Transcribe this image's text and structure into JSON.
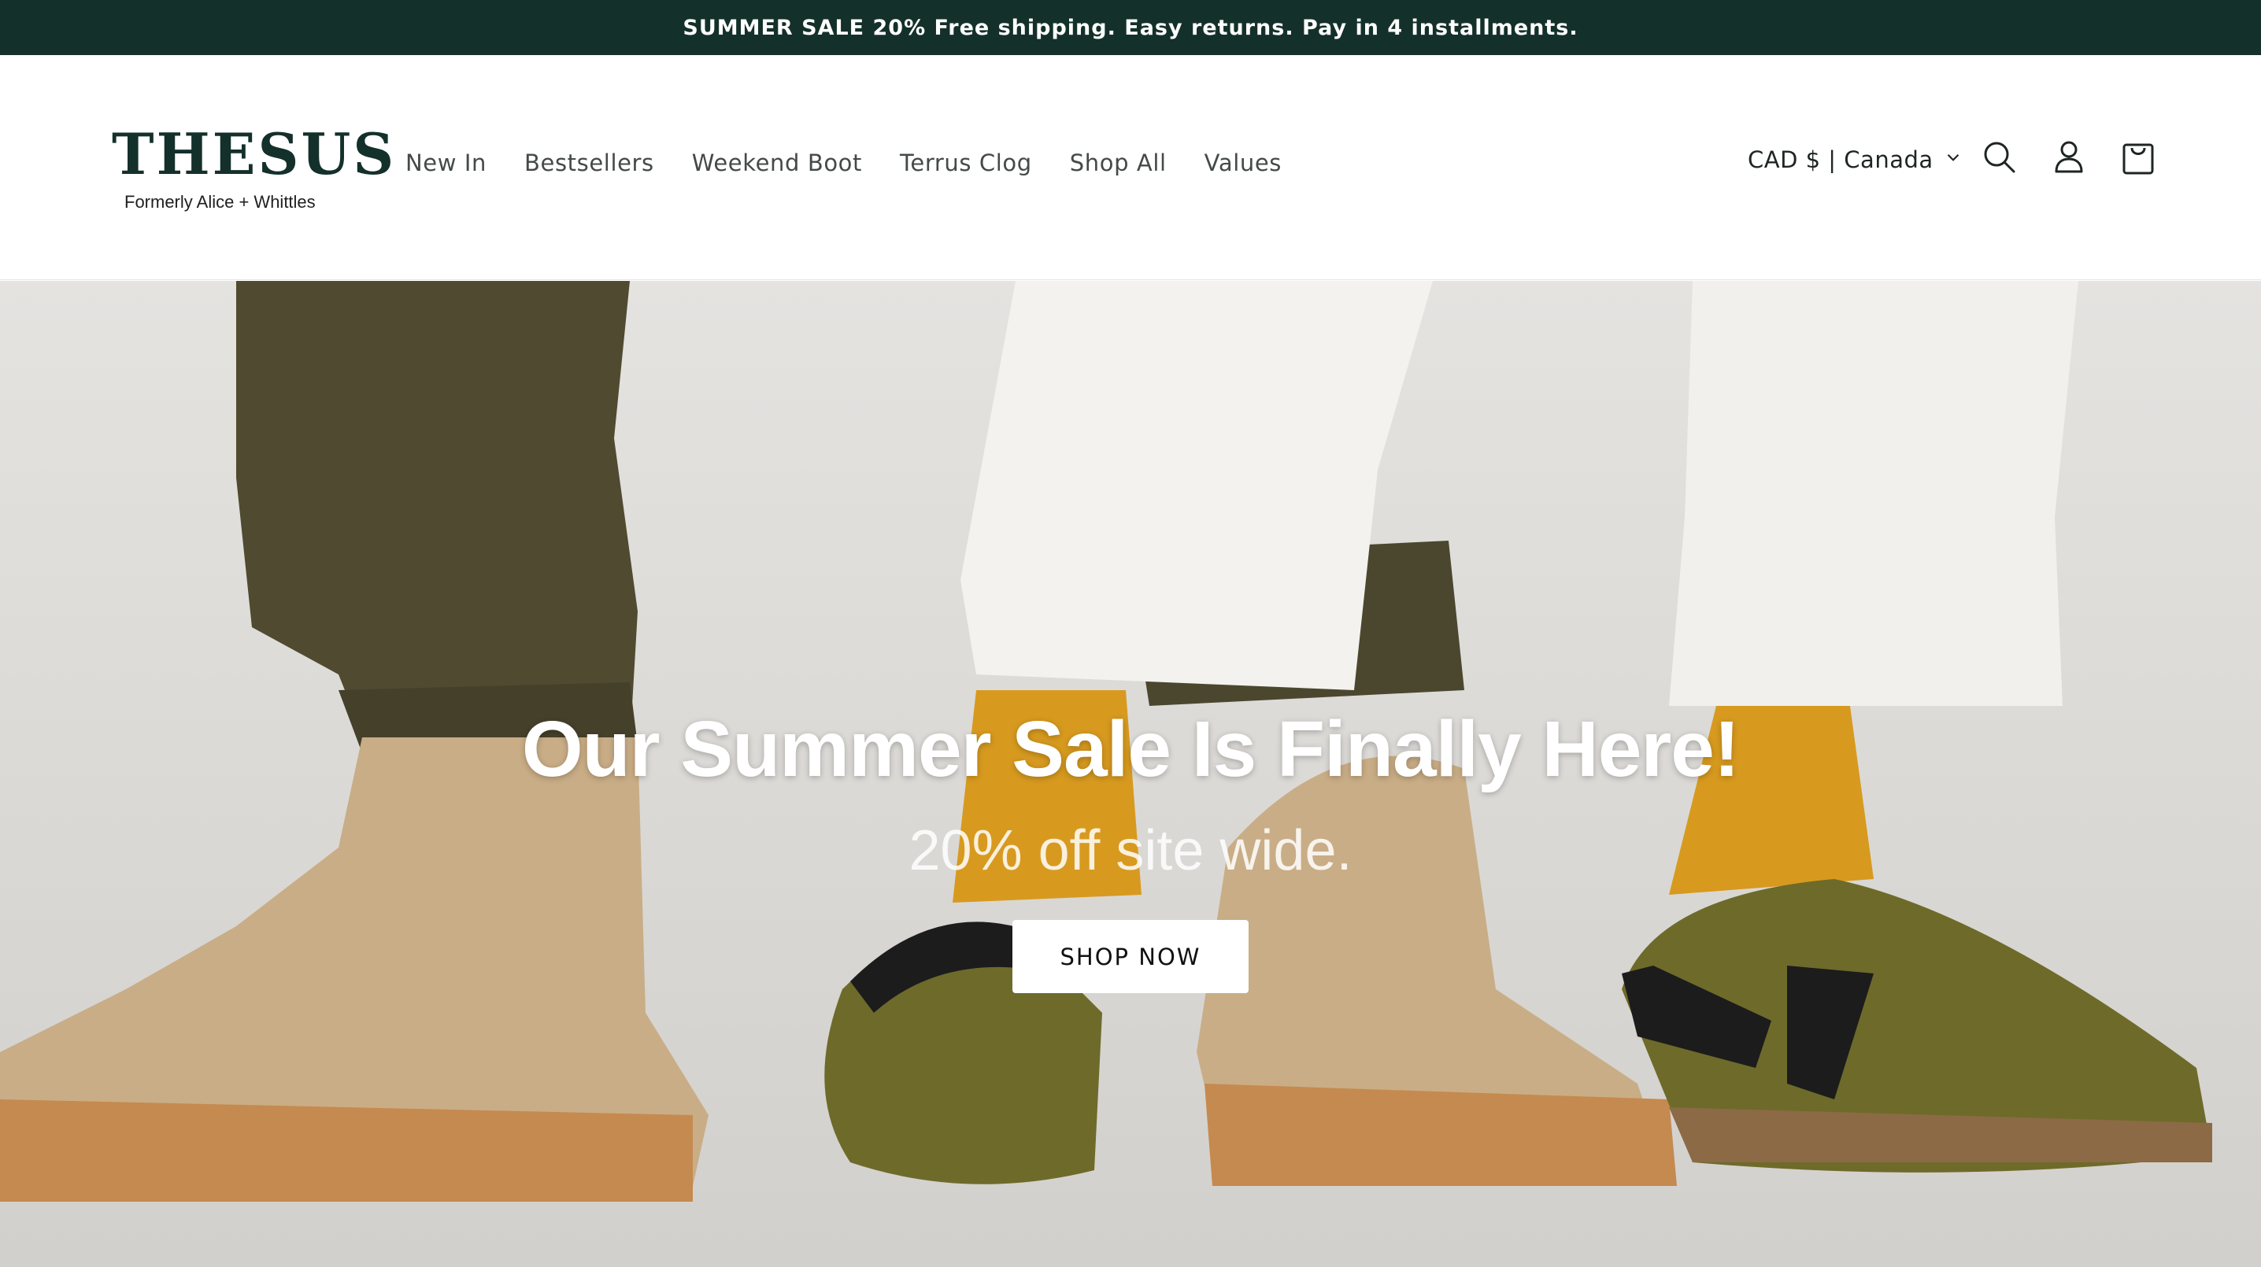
{
  "announcement": {
    "text": "SUMMER SALE 20% Free shipping. Easy returns. Pay in 4 installments."
  },
  "brand": {
    "name": "THESUS",
    "tagline": "Formerly Alice + Whittles",
    "color": "#14302a"
  },
  "nav": {
    "items": [
      {
        "label": "New In"
      },
      {
        "label": "Bestsellers"
      },
      {
        "label": "Weekend Boot"
      },
      {
        "label": "Terrus Clog"
      },
      {
        "label": "Shop All"
      },
      {
        "label": "Values"
      }
    ]
  },
  "header_tools": {
    "region": "CAD $ | Canada",
    "icons": [
      "search-icon",
      "account-icon",
      "cart-icon"
    ]
  },
  "hero": {
    "title": "Our Summer Sale Is Finally Here!",
    "subtitle": "20% off site wide.",
    "cta": "SHOP NOW"
  },
  "colors": {
    "announcement_bg": "#14302a",
    "boot_tan": "#c9ad86",
    "clog_olive": "#6e6a2a",
    "sock_mustard": "#d79a1f",
    "pant_olive": "#4f4a30"
  }
}
